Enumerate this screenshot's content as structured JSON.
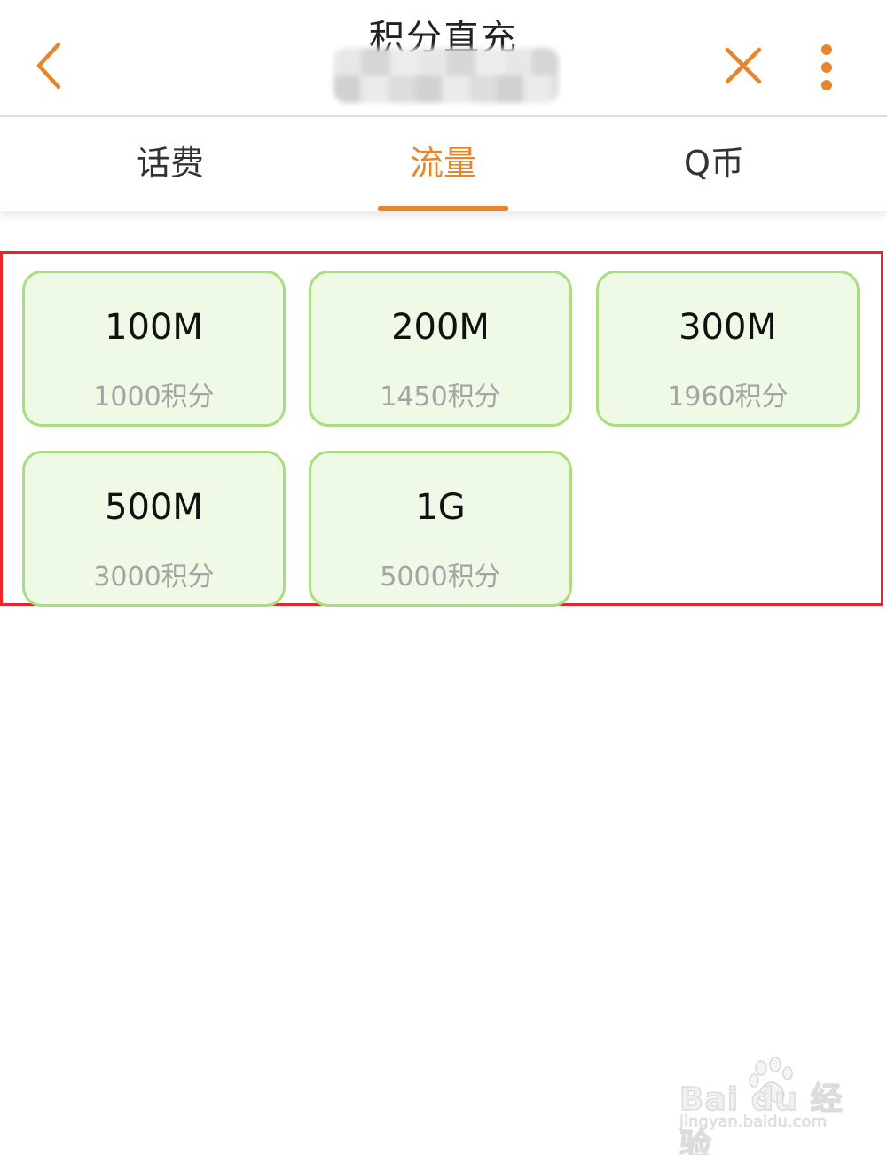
{
  "header": {
    "title": "积分直充"
  },
  "tabs": [
    {
      "label": "话费",
      "active": false
    },
    {
      "label": "流量",
      "active": true
    },
    {
      "label": "Q币",
      "active": false
    }
  ],
  "packages": [
    {
      "amount": "100M",
      "points": "1000积分"
    },
    {
      "amount": "200M",
      "points": "1450积分"
    },
    {
      "amount": "300M",
      "points": "1960积分"
    },
    {
      "amount": "500M",
      "points": "3000积分"
    },
    {
      "amount": "1G",
      "points": "5000积分"
    }
  ],
  "watermark": {
    "brand": "Bai du 经验",
    "url": "jingyan.baidu.com"
  },
  "colors": {
    "accent": "#e8842a",
    "card_bg": "#eef9e6",
    "card_border": "#a9dd7e",
    "highlight": "#e8262a"
  },
  "icons": {
    "back": "chevron-left-icon",
    "close": "close-icon",
    "more": "more-vertical-icon"
  }
}
